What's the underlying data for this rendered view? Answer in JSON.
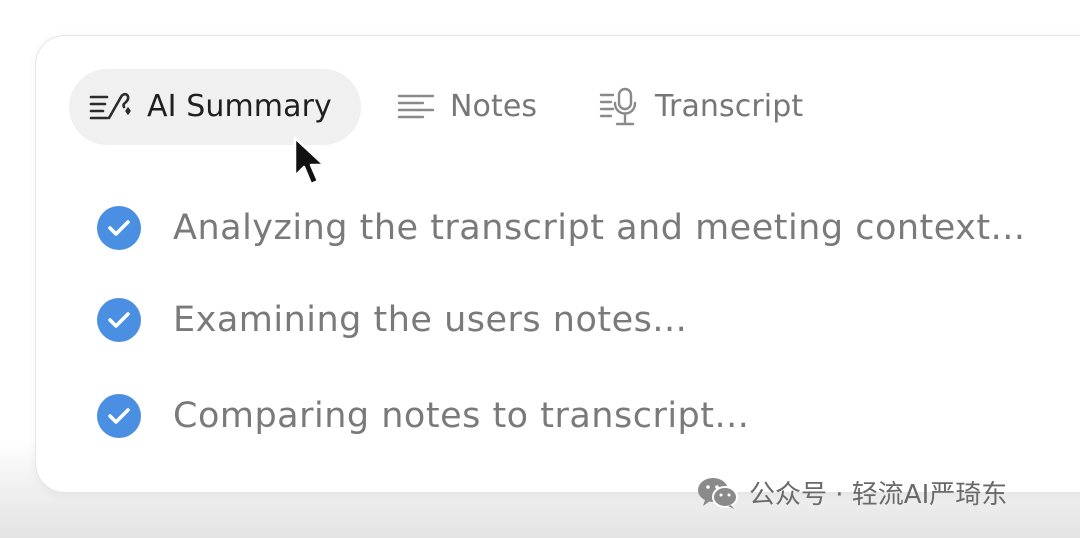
{
  "tabs": {
    "ai_summary": {
      "label": "AI Summary",
      "icon": "ai-summary-icon",
      "active": true
    },
    "notes": {
      "label": "Notes",
      "icon": "notes-lines-icon",
      "active": false
    },
    "transcript": {
      "label": "Transcript",
      "icon": "transcript-mic-icon",
      "active": false
    }
  },
  "steps": [
    {
      "label": "Analyzing the transcript and meeting context...",
      "status": "done",
      "icon": "check-circle-icon"
    },
    {
      "label": "Examining the users notes...",
      "status": "done",
      "icon": "check-circle-icon"
    },
    {
      "label": "Comparing notes to transcript...",
      "status": "done",
      "icon": "check-circle-icon"
    }
  ],
  "watermark": {
    "text": "公众号 · 轻流AI严琦东",
    "icon": "wechat-icon"
  },
  "colors": {
    "check_blue": "#4a8fe2",
    "active_tab_bg": "#f0f0f0",
    "step_text": "#7a7a7a",
    "inactive_tab_text": "#777777",
    "active_tab_text": "#1f1f1f"
  }
}
